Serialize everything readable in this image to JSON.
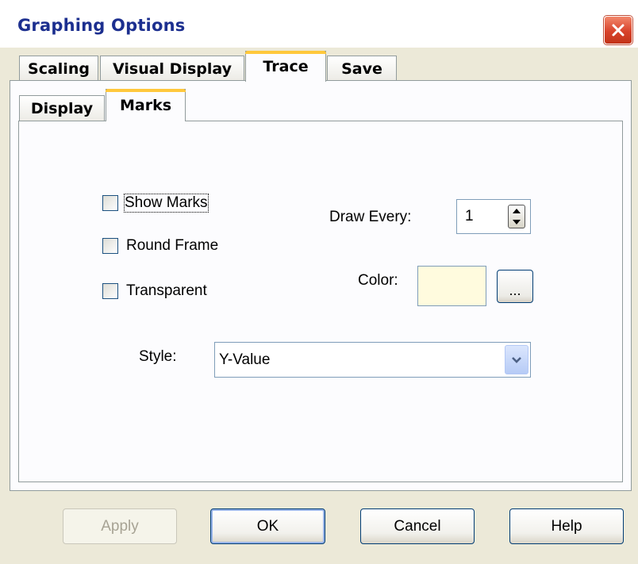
{
  "window": {
    "title": "Graphing Options"
  },
  "tabs": [
    {
      "label": "Scaling"
    },
    {
      "label": "Visual Display"
    },
    {
      "label": "Trace"
    },
    {
      "label": "Save"
    }
  ],
  "subtabs": [
    {
      "label": "Display"
    },
    {
      "label": "Marks"
    }
  ],
  "marks": {
    "show_marks": {
      "label": "Show Marks",
      "checked": false
    },
    "round_frame": {
      "label": "Round Frame",
      "checked": false
    },
    "transparent": {
      "label": "Transparent",
      "checked": false
    },
    "draw_every_label": "Draw Every:",
    "draw_every_value": "1",
    "color_label": "Color:",
    "color_value": "#fffbde",
    "color_button_label": "...",
    "style_label": "Style:",
    "style_value": "Y-Value"
  },
  "buttons": {
    "apply": "Apply",
    "ok": "OK",
    "cancel": "Cancel",
    "help": "Help"
  }
}
